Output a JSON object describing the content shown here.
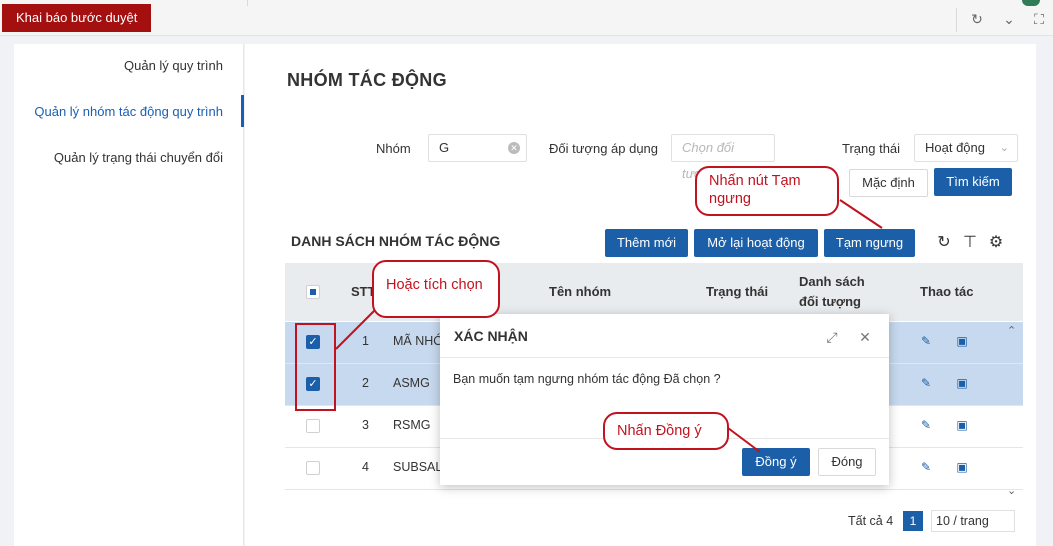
{
  "top": {
    "tab_label": "Khai báo bước duyệt"
  },
  "sidebar": {
    "items": [
      {
        "label": "Quản lý quy trình"
      },
      {
        "label": "Quản lý nhóm tác động quy trình"
      },
      {
        "label": "Quản lý trạng thái chuyển đổi"
      }
    ]
  },
  "page": {
    "title": "NHÓM TÁC ĐỘNG"
  },
  "filters": {
    "group_label": "Nhóm",
    "group_value": "G",
    "target_label": "Đối tượng áp dụng",
    "target_placeholder": "Chọn đối tượ...",
    "status_label": "Trạng thái",
    "status_value": "Hoạt động",
    "default_button": "Mặc định",
    "search_button": "Tìm kiếm"
  },
  "list": {
    "title": "DANH SÁCH NHÓM TÁC ĐỘNG",
    "add_button": "Thêm mới",
    "reopen_button": "Mở lại hoạt động",
    "pause_button": "Tạm ngưng",
    "columns": {
      "stt": "STT",
      "name": "Tên nhóm",
      "status": "Trạng thái",
      "targets_line1": "Danh sách",
      "targets_line2": "đối tượng",
      "actions": "Thao tác"
    },
    "rows": [
      {
        "stt": "1",
        "code": "MÃ NHÓM",
        "checked": true
      },
      {
        "stt": "2",
        "code": "ASMG",
        "checked": true
      },
      {
        "stt": "3",
        "code": "RSMG",
        "checked": false
      },
      {
        "stt": "4",
        "code": "SUBSALE",
        "checked": false
      }
    ]
  },
  "pagination": {
    "total": "Tất cả 4",
    "current": "1",
    "page_size": "10 / trang"
  },
  "modal": {
    "title": "XÁC NHẬN",
    "message": "Bạn muốn tạm ngưng nhóm tác động Đã chọn ?",
    "ok_button": "Đồng ý",
    "close_button": "Đóng"
  },
  "callouts": {
    "pause": "Nhấn nút Tạm ngưng",
    "check": "Hoặc tích chọn",
    "agree": "Nhấn Đồng ý"
  },
  "colors": {
    "brand": "#1b5fa8",
    "tab_red": "#a40f0f",
    "annotation_red": "#c1121f",
    "selected_row": "#c7d9ee"
  }
}
